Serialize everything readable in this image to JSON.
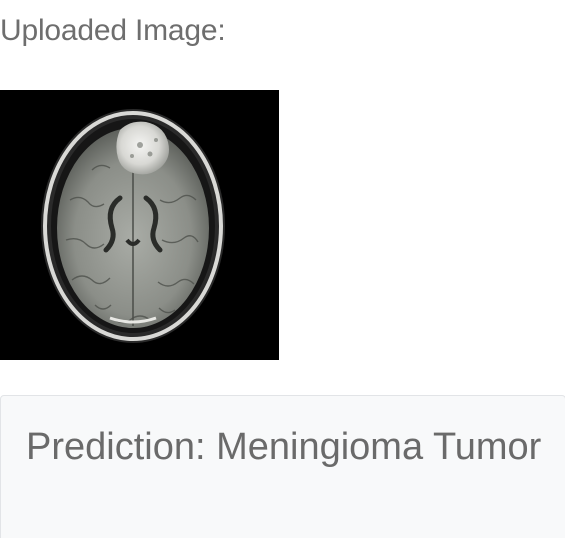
{
  "upload_section": {
    "heading": "Uploaded Image:"
  },
  "result_card": {
    "prediction_text": "Prediction: Meningioma Tumor"
  },
  "colors": {
    "text": "#6e6e6e",
    "card_background": "#f8f9fa",
    "card_border": "#e2e4e7",
    "image_background": "#000000"
  }
}
